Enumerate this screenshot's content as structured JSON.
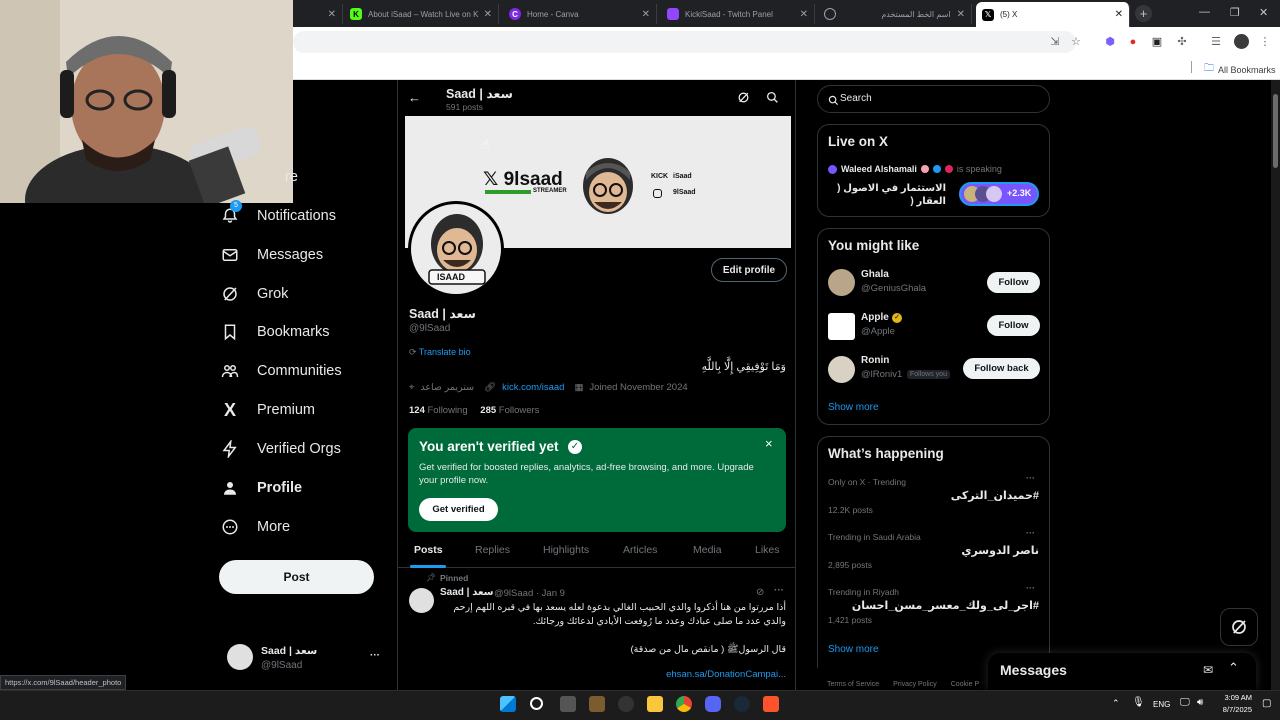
{
  "browser": {
    "tabs": [
      {
        "title": "About iSaad – Watch Live on K",
        "icon": "kick-icon",
        "color": "#53fc18"
      },
      {
        "title": "Home - Canva",
        "icon": "canva-icon",
        "color": "#7d2ae8"
      },
      {
        "title": "KickiSaad - Twitch Panel",
        "icon": "twitch-panel-icon",
        "color": "#9146ff"
      },
      {
        "title": "اسم الخط المستخدم",
        "icon": "globe-icon",
        "color": "#9aa0a6"
      },
      {
        "title": "(5) X",
        "icon": "x-icon",
        "color": "#000000"
      }
    ],
    "all_bookmarks": "All Bookmarks",
    "status_url": "https://x.com/9lSaad/header_photo"
  },
  "nav": {
    "notifications_badge": "5",
    "items": [
      {
        "label": "re"
      },
      {
        "label": "Notifications"
      },
      {
        "label": "Messages"
      },
      {
        "label": "Grok"
      },
      {
        "label": "Bookmarks"
      },
      {
        "label": "Communities"
      },
      {
        "label": "Premium"
      },
      {
        "label": "Verified Orgs"
      },
      {
        "label": "Profile"
      },
      {
        "label": "More"
      }
    ],
    "post_label": "Post",
    "account": {
      "name": "Saad | سعد",
      "handle": "@9lSaad",
      "more": "···"
    }
  },
  "profile": {
    "header_name": "Saad | سعد",
    "post_count": "591 posts",
    "banner": {
      "logo_text": "9lsaad",
      "streamer_text": "STREAMER",
      "kick_label": "KICK",
      "kick_name": "iSaad",
      "ig_name": "9lSaad"
    },
    "avatar_label": "ISAAD",
    "edit_profile": "Edit profile",
    "name": "Saad | سعد",
    "handle": "@9lSaad",
    "translate_bio": "Translate bio",
    "bio": "وَمَا تَوْفِيقِي إِلَّا بِاللَّهِ",
    "category": "ستريمر صاعد",
    "website": "kick.com/isaad",
    "joined": "Joined November 2024",
    "following_count": "124",
    "following_label": "Following",
    "followers_count": "285",
    "followers_label": "Followers"
  },
  "verify_banner": {
    "title": "You aren't verified yet",
    "body": "Get verified for boosted replies, analytics, ad-free browsing, and more. Upgrade your profile now.",
    "button": "Get verified",
    "close": "×",
    "bg_color": "#006b3a"
  },
  "tabs": [
    "Posts",
    "Replies",
    "Highlights",
    "Articles",
    "Media",
    "Likes"
  ],
  "pinned_post": {
    "pinned_label": "Pinned",
    "author": "Saad | سعد",
    "handle_time": "@9lSaad · Jan 9",
    "more": "···",
    "line1": "أذا مررتوا من هنا أذكروا والدي الحبيب الغالي بدعوة لعله يسعد بها في قبره اللهم إرحم",
    "line2": "والدي عدد ما صلى عبادك وعدد ما رُوفعت الأيادي لدعائك ورجائك.",
    "line3": "قال الرسولﷺ ( مانقص مال من صدقة)",
    "link": "ehsan.sa/DonationCampai..."
  },
  "right": {
    "search_placeholder": "Search",
    "live": {
      "title": "Live on X",
      "host": "Waleed Alshamali",
      "speaking": "is speaking",
      "space_title": "الاستثمار في الاصول ( العقار (",
      "listeners": "+2.3K"
    },
    "might_like": {
      "title": "You might like",
      "users": [
        {
          "name": "Ghala",
          "handle": "@GeniusGhala",
          "button": "Follow",
          "follows_you": ""
        },
        {
          "name": "Apple",
          "handle": "@Apple",
          "button": "Follow",
          "follows_you": ""
        },
        {
          "name": "Ronin",
          "handle": "@lRoniv1",
          "button": "Follow back",
          "follows_you": "Follows you"
        }
      ],
      "show_more": "Show more"
    },
    "happening": {
      "title": "What’s happening",
      "trends": [
        {
          "context": "Only on X · Trending",
          "topic": "#حمیدان_الترکی",
          "posts": "12.2K posts"
        },
        {
          "context": "Trending in Saudi Arabia",
          "topic": "ناصر الدوسري",
          "posts": "2,895 posts"
        },
        {
          "context": "Trending in Riyadh",
          "topic": "#اجر_لی_ولك_معسر_مسن_احسان",
          "posts": "1,421 posts"
        }
      ],
      "show_more": "Show more"
    },
    "footer_links": [
      "Terms of Service",
      "Privacy Policy",
      "Cookie P"
    ]
  },
  "messages_drawer": {
    "title": "Messages"
  },
  "taskbar": {
    "lang": "ENG",
    "time": "3:09 AM",
    "date": "8/7/2025"
  },
  "colors": {
    "accent": "#1d9bf0",
    "verify_green": "#006b3a",
    "gold": "#e2b719"
  }
}
